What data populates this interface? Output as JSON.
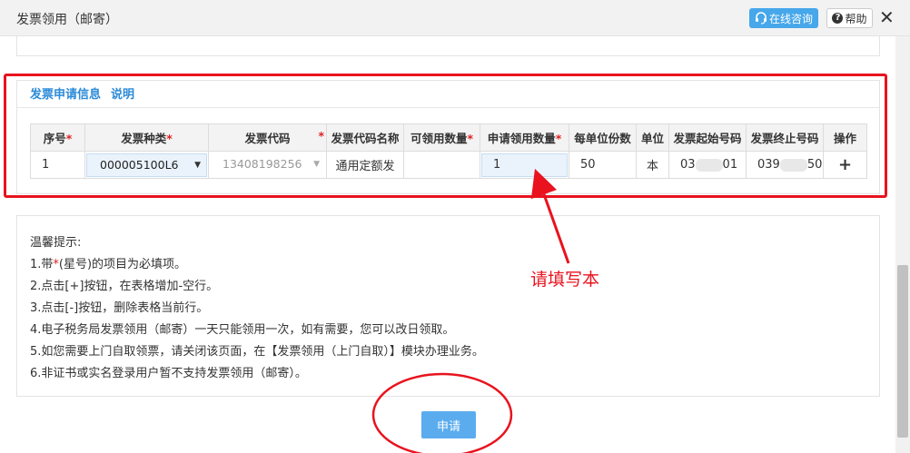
{
  "window": {
    "title": "发票领用（邮寄）",
    "consult_label": "在线咨询",
    "help_label": "帮助",
    "close_glyph": "✕"
  },
  "section": {
    "title": "发票申请信息",
    "link": "说明"
  },
  "table": {
    "headers": [
      "序号",
      "发票种类",
      "发票代码",
      "发票代码名称",
      "可领用数量",
      "申请领用数量",
      "每单位份数",
      "单位",
      "发票起始号码",
      "发票终止号码",
      "操作"
    ],
    "required_mark": "*",
    "row": {
      "index": "1",
      "invoice_type": "000005100L6",
      "invoice_code": "13408198256",
      "code_name": "通用定额发",
      "available_qty": "",
      "apply_qty": "1",
      "per_unit": "50",
      "unit": "本",
      "start_no_prefix": "03",
      "start_no_suffix": "01",
      "end_no_prefix": "039",
      "end_no_suffix": "50",
      "op_glyph": "+"
    }
  },
  "tips": {
    "title": "温馨提示:",
    "line1_pre": "1.带",
    "line1_star": "*",
    "line1_post": "(星号)的项目为必填项。",
    "line2": "2.点击[+]按钮，在表格增加-空行。",
    "line3": "3.点击[-]按钮，删除表格当前行。",
    "line4": "4.电子税务局发票领用（邮寄）一天只能领用一次，如有需要，您可以改日领取。",
    "line5": "5.如您需要上门自取领票，请关闭该页面，在【发票领用（上门自取）】模块办理业务。",
    "line6": "6.非证书或实名登录用户暂不支持发票领用（邮寄）。"
  },
  "apply_button": "申请",
  "annotation": "请填写本",
  "colors": {
    "accent": "#46a7ea",
    "annotation_red": "#e8131e",
    "section_blue": "#2b8ad8"
  },
  "icons": {
    "consult": "headset-icon",
    "help": "question-icon",
    "close": "close-icon",
    "dropdown": "caret-down-icon",
    "add": "plus-icon"
  }
}
